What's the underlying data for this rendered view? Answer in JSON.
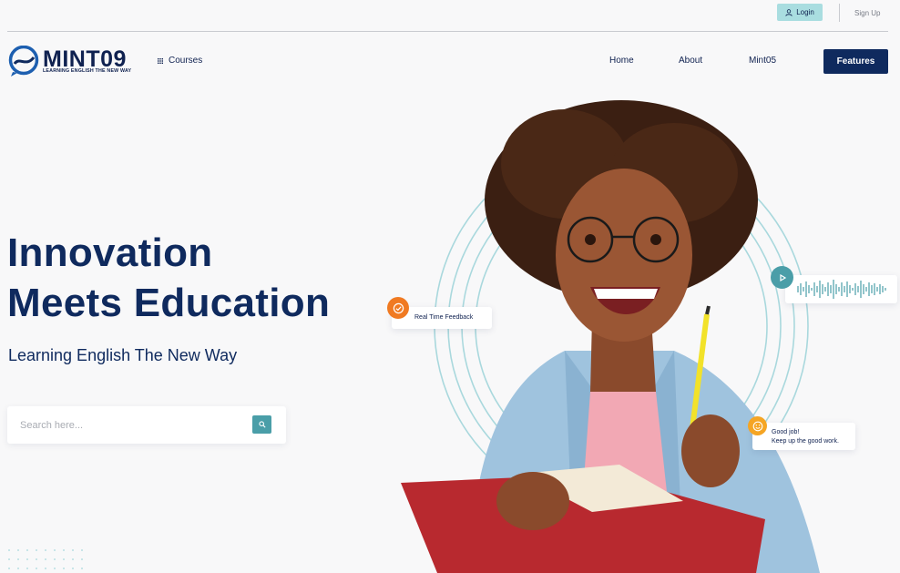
{
  "topbar": {
    "login_label": "Login",
    "signup_label": "Sign Up"
  },
  "brand": {
    "name": "MINT09",
    "tagline": "LEARNING ENGLISH THE NEW WAY"
  },
  "nav": {
    "courses_label": "Courses",
    "items": [
      {
        "label": "Home"
      },
      {
        "label": "About"
      },
      {
        "label": "Mint05"
      }
    ],
    "cta_label": "Features"
  },
  "hero": {
    "title_line1": "Innovation",
    "title_line2": "Meets Education",
    "subtitle": "Learning English The New Way",
    "search_placeholder": "Search here..."
  },
  "cards": {
    "feedback": "Real Time Feedback",
    "goodjob_line1": "Good job!",
    "goodjob_line2": "Keep up the good work."
  },
  "icons": {
    "login": "user-icon",
    "courses": "grid-icon",
    "search": "search-icon",
    "feedback": "check-circle-icon",
    "audio": "play-icon",
    "goodjob": "smile-icon"
  },
  "colors": {
    "navy": "#0f2a5e",
    "teal": "#4a9ea8",
    "light_teal": "#a9dde0",
    "orange": "#f07a22",
    "yellow": "#f5a524",
    "background": "#f8f8f9"
  }
}
